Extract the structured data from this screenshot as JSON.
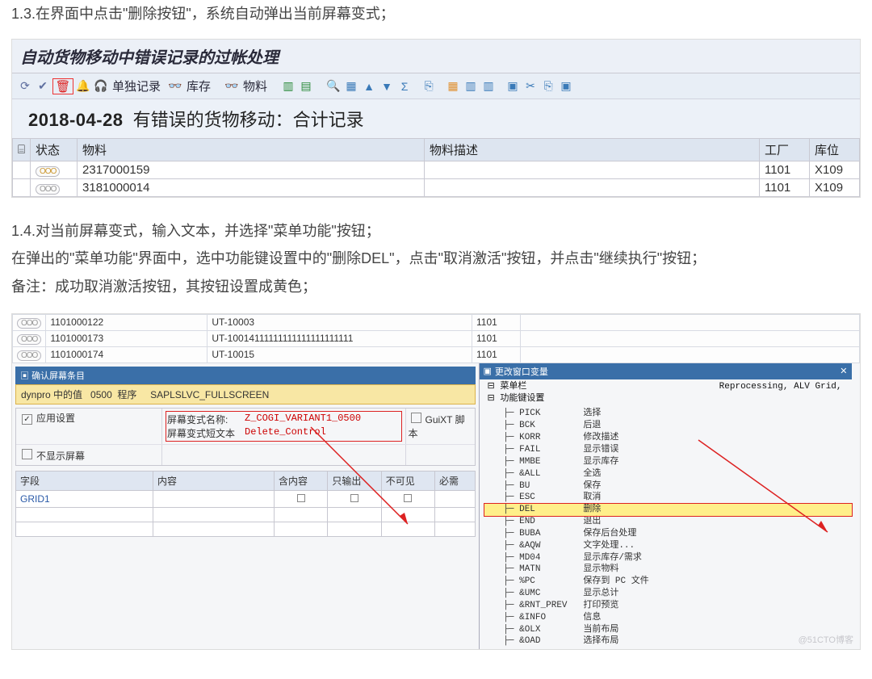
{
  "paragraphs": {
    "p13": "1.3.在界面中点击\"删除按钮\"，系统自动弹出当前屏幕变式；",
    "p14a": "1.4.对当前屏幕变式，输入文本，并选择\"菜单功能\"按钮；",
    "p14b": "在弹出的\"菜单功能\"界面中，选中功能键设置中的\"删除DEL\"，点击\"取消激活\"按钮，并点击\"继续执行\"按钮；",
    "p14c": "备注：成功取消激活按钮，其按钮设置成黄色；"
  },
  "sap1": {
    "title": "自动货物移动中错误记录的过帐处理",
    "tb": {
      "single": "单独记录",
      "stock": "库存",
      "material": "物料"
    },
    "subheader": {
      "date": "2018-04-28",
      "txt": "有错误的货物移动：合计记录"
    },
    "cols": {
      "state": "状态",
      "matnr": "物料",
      "desc": "物料描述",
      "plant": "工厂",
      "sloc": "库位"
    },
    "rows": [
      {
        "matnr": "2317000159",
        "desc": "",
        "plant": "1101",
        "sloc": "X109"
      },
      {
        "matnr": "3181000014",
        "desc": "",
        "plant": "1101",
        "sloc": "X109"
      }
    ]
  },
  "sap2": {
    "top_rows": [
      {
        "m": "1101000122",
        "u": "UT-10003",
        "p": "1101"
      },
      {
        "m": "1101000173",
        "u": "UT-10014111111111111111111111",
        "p": "1101"
      },
      {
        "m": "1101000174",
        "u": "UT-10015",
        "p": "1101"
      }
    ],
    "left": {
      "bar": "确认屏幕条目",
      "dynpro": {
        "label": "dynpro 中的值",
        "screen": "0500",
        "prog_lbl": "程序",
        "prog": "SAPLSLVC_FULLSCREEN"
      },
      "apply": "应用设置",
      "noshow": "不显示屏幕",
      "var_name_lbl": "屏幕变式名称:",
      "var_name": "Z_COGI_VARIANT1_0500",
      "var_txt_lbl": "屏幕变式短文本",
      "var_txt": "Delete_Control",
      "guixt": "GuiXT 脚本",
      "cols": {
        "f": "字段",
        "c": "内容",
        "i": "含内容",
        "o": "只输出",
        "h": "不可见",
        "m": "必需"
      },
      "grid_field": "GRID1"
    },
    "right": {
      "title": "更改窗口变量",
      "root1": "菜单栏",
      "root1_extra": "Reprocessing, ALV Grid,",
      "root2": "功能键设置",
      "fkeys": [
        {
          "c": "PICK",
          "t": "选择"
        },
        {
          "c": "BCK",
          "t": "后退"
        },
        {
          "c": "KORR",
          "t": "修改描述"
        },
        {
          "c": "FAIL",
          "t": "显示错误"
        },
        {
          "c": "MMBE",
          "t": "显示库存"
        },
        {
          "c": "&ALL",
          "t": "全选"
        },
        {
          "c": "BU",
          "t": "保存"
        },
        {
          "c": "ESC",
          "t": "取消"
        },
        {
          "c": "DEL",
          "t": "删除"
        },
        {
          "c": "END",
          "t": "退出"
        },
        {
          "c": "BUBA",
          "t": "保存后台处理"
        },
        {
          "c": "&AQW",
          "t": "文字处理..."
        },
        {
          "c": "MD04",
          "t": "显示库存/需求"
        },
        {
          "c": "MATN",
          "t": "显示物料"
        },
        {
          "c": "%PC",
          "t": "保存到 PC 文件"
        },
        {
          "c": "&UMC",
          "t": "显示总计"
        },
        {
          "c": "&RNT_PREV",
          "t": "打印预览"
        },
        {
          "c": "&INFO",
          "t": "信息"
        },
        {
          "c": "&OLX",
          "t": "当前布局"
        },
        {
          "c": "&OAD",
          "t": "选择布局"
        }
      ]
    }
  },
  "watermark": "@51CTO博客"
}
